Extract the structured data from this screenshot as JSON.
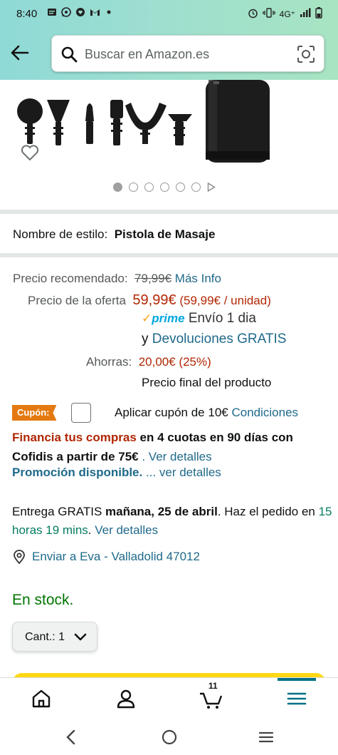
{
  "status_bar": {
    "time": "8:40",
    "network": "4G⁺",
    "left_icons": [
      "message-icon",
      "whatsapp-icon",
      "heart-app-icon",
      "gmail-icon",
      "dot-icon"
    ],
    "right_icons": [
      "alarm-icon",
      "vibrate-icon",
      "signal-icon",
      "battery-icon"
    ]
  },
  "search": {
    "placeholder": "Buscar en Amazon.es"
  },
  "gallery": {
    "image_count": 6,
    "active_index": 0
  },
  "style": {
    "label": "Nombre de estilo:",
    "value": "Pistola de Masaje"
  },
  "price": {
    "recommended_label": "Precio recomendado:",
    "recommended_value": "79,99€",
    "recommended_link": "Más Info",
    "offer_label": "Precio de la oferta",
    "offer_value": "59,99€",
    "offer_unit": "(59,99€ / unidad)",
    "prime_label": "prime",
    "prime_delivery": "Envío 1 dia",
    "returns_prefix": "y",
    "returns_link": "Devoluciones GRATIS",
    "savings_label": "Ahorras:",
    "savings_value": "20,00€ (25%)",
    "final_note": "Precio final del producto"
  },
  "coupon": {
    "badge": "Cupón:",
    "text": "Aplicar cupón de 10€",
    "link": "Condiciones",
    "checked": false
  },
  "financing": {
    "lead": "Financia tus compras",
    "body": " en 4 cuotas en 90 días con Cofidis a partir de 75€",
    "link": ". Ver detalles"
  },
  "promotion": {
    "label": "Promoción disponible.",
    "link": "... ver detalles"
  },
  "delivery": {
    "prefix": "Entrega GRATIS ",
    "date": "mañana, 25 de abril",
    "middle": ". Haz el pedido en ",
    "countdown": "15 horas 19 mins",
    "link": "Ver detalles"
  },
  "ship_to": "Enviar a Eva - Valladolid 47012",
  "stock": "En stock.",
  "quantity": {
    "label": "Cant.:",
    "value": "1"
  },
  "bottom_nav": {
    "items": [
      "home-icon",
      "account-icon",
      "cart-icon",
      "menu-icon"
    ],
    "cart_count": "11",
    "active": "menu-icon",
    "accent": "#007185"
  },
  "colors": {
    "header_gradient": "#8fd9d6",
    "price_red": "#b12704",
    "link": "#1f6a8a",
    "stock_green": "#007600",
    "coupon_orange": "#e47911",
    "buy_yellow": "#ffd814"
  }
}
